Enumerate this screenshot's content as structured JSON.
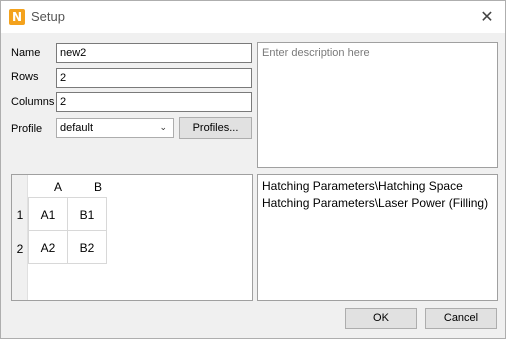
{
  "window": {
    "title": "Setup",
    "app_icon_letter": "N"
  },
  "form": {
    "name_label": "Name",
    "name_value": "new2",
    "rows_label": "Rows",
    "rows_value": "2",
    "columns_label": "Columns",
    "columns_value": "2",
    "profile_label": "Profile",
    "profile_value": "default",
    "profiles_button": "Profiles..."
  },
  "description": {
    "placeholder": "Enter description here"
  },
  "grid": {
    "col_headers": [
      "A",
      "B"
    ],
    "row_headers": [
      "1",
      "2"
    ],
    "cells": [
      [
        "A1",
        "B1"
      ],
      [
        "A2",
        "B2"
      ]
    ]
  },
  "parameters": [
    "Hatching Parameters\\Hatching Space",
    "Hatching Parameters\\Laser Power (Filling)"
  ],
  "buttons": {
    "ok": "OK",
    "cancel": "Cancel"
  }
}
